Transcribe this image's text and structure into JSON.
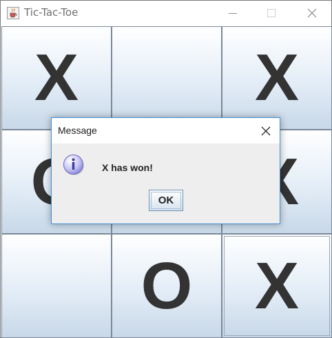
{
  "window": {
    "title": "Tic-Tac-Toe",
    "icon": "java-cup-icon",
    "controls": [
      "minimize-icon",
      "maximize-icon",
      "close-icon"
    ]
  },
  "board": {
    "cells": [
      "X",
      "",
      "X",
      "O",
      "",
      "X",
      "",
      "O",
      "X"
    ]
  },
  "dialog": {
    "title": "Message",
    "icon": "info-icon",
    "message": "X has won!",
    "ok_label": "OK"
  },
  "colors": {
    "mark": "#333333",
    "dialog_border": "#3d8fd6",
    "dialog_body": "#eeeeee",
    "cell_gradient_bottom": "#c8d8e8"
  }
}
